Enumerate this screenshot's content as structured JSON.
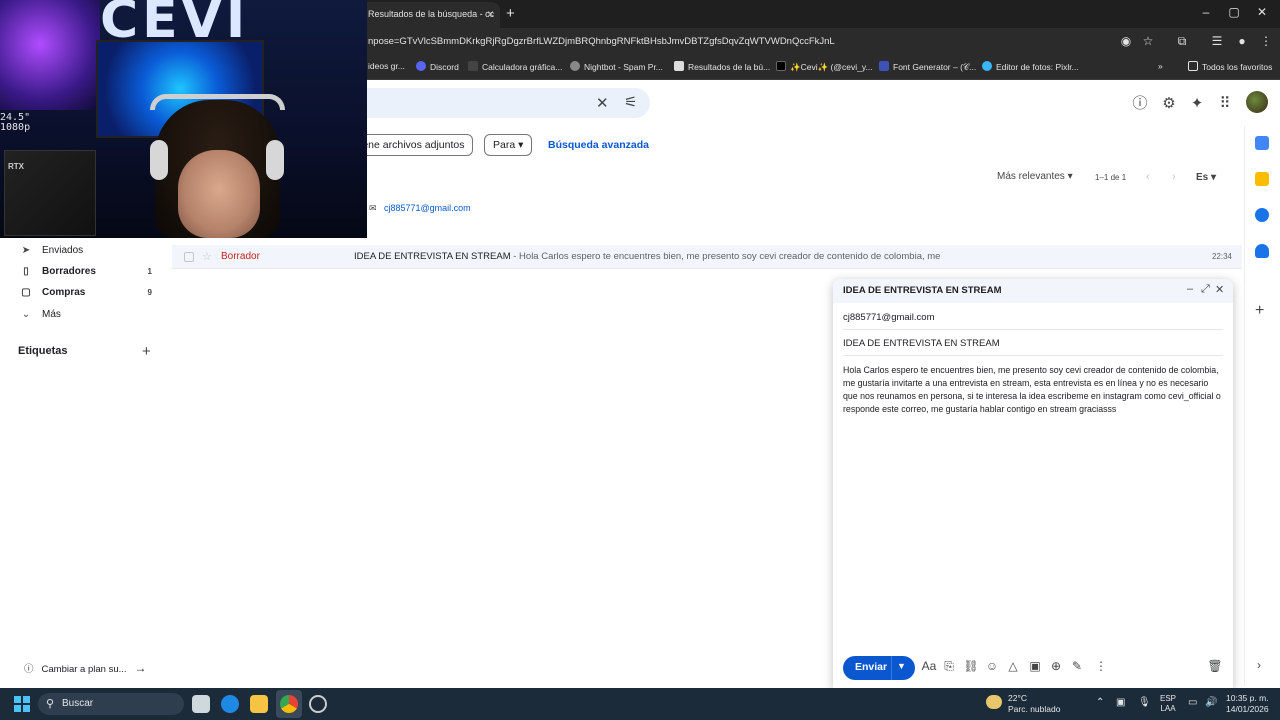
{
  "browser": {
    "tab_title": "Resultados de la búsqueda - cc",
    "tab_close": "×",
    "new_tab": "+",
    "url": "npose=GTvVlcSBmmDKrkgRjRgDgzrBrfLWZDjmBRQhnbgRNFktBHsbJmvDBTZgfsDqvZqWTVWDnQccFkJnL",
    "bookmarks": [
      {
        "label": "ideos gr..."
      },
      {
        "label": "Discord"
      },
      {
        "label": "Calculadora gráfica..."
      },
      {
        "label": "Nightbot - Spam Pr..."
      },
      {
        "label": "Resultados de la bú..."
      },
      {
        "label": "✨Cevi✨ (@cevi_y..."
      },
      {
        "label": "Font Generator – (𝒞..."
      },
      {
        "label": "Editor de fotos: Pixlr..."
      }
    ],
    "all_favorites": "Todos los favoritos",
    "more_bookmarks": "»"
  },
  "gmail": {
    "chips": [
      "iene archivos adjuntos",
      "Para ▾"
    ],
    "advanced_search": "Búsqueda avanzada",
    "relevance": "Más relevantes ▾",
    "count": "1–1 de 1",
    "lang": "Es ▾",
    "contact": "cj885771@gmail.com",
    "nav": [
      {
        "label": "Enviados",
        "count": "",
        "icon": "➤",
        "bold": false
      },
      {
        "label": "Borradores",
        "count": "1",
        "icon": "▯",
        "bold": true
      },
      {
        "label": "Compras",
        "count": "9",
        "icon": "▢",
        "bold": true
      },
      {
        "label": "Más",
        "count": "",
        "icon": "⌄",
        "bold": false
      }
    ],
    "labels_title": "Etiquetas",
    "labels_add": "+",
    "plan": "Cambiar a plan su...",
    "row": {
      "sender": "Borrador",
      "subject": "IDEA DE ENTREVISTA EN STREAM",
      "snippet": " - Hola Carlos espero te encuentres bien, me presento soy cevi creador de contenido de colombia, me",
      "time": "22:34"
    }
  },
  "compose": {
    "title": "IDEA DE ENTREVISTA EN STREAM",
    "to": "cj885771@gmail.com",
    "subject": "IDEA DE ENTREVISTA EN STREAM",
    "body": "Hola Carlos espero te encuentres bien, me presento soy cevi creador de contenido de colombia, me gustaría invitarte a una entrevista en stream, esta entrevista es en línea y no es necesario que nos reunamos en persona, si te interesa la idea escribeme en instagram como cevi_official o responde este correo, me gustaría hablar contigo en stream graciasss",
    "send": "Enviar",
    "format": "Aa"
  },
  "webcam": {
    "logo": "CEVI",
    "osd": "24.5\"\n1080p",
    "gpu": "RTX"
  },
  "taskbar": {
    "search": "Buscar",
    "weather_temp": "22°C",
    "weather_desc": "Parc. nublado",
    "lang": "ESP\nLAA",
    "time": "10:35 p. m.",
    "date": "14/01/2026"
  }
}
